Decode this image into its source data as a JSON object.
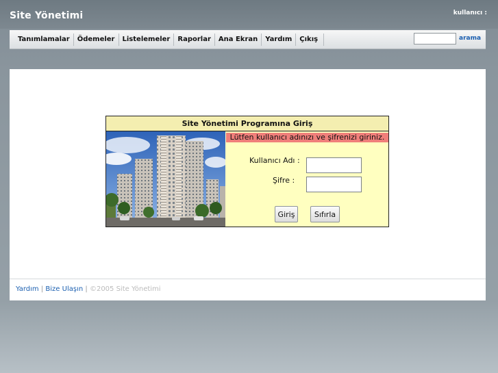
{
  "header": {
    "site_title": "Site Yönetimi",
    "user_label": "kullanıcı :"
  },
  "nav": {
    "items": [
      {
        "label": "Tanımlamalar"
      },
      {
        "label": "Ödemeler"
      },
      {
        "label": "Listelemeler"
      },
      {
        "label": "Raporlar"
      },
      {
        "label": "Ana Ekran"
      },
      {
        "label": "Yardım"
      },
      {
        "label": "Çıkış"
      }
    ],
    "search_value": "",
    "search_link": "arama"
  },
  "login": {
    "title": "Site Yönetimi Programına Giriş",
    "error_message": "Lütfen kullanıcı adınızı ve şifrenizi giriniz.",
    "username_label": "Kullanıcı Adı :",
    "username_value": "",
    "password_label": "Şifre :",
    "password_value": "",
    "submit_label": "Giriş",
    "reset_label": "Sıfırla"
  },
  "footer": {
    "help_link": "Yardım",
    "contact_link": "Bize Ulaşın",
    "separator": "|",
    "copyright": "©2005 Site Yönetimi"
  },
  "colors": {
    "error_bg": "#f07f7a",
    "login_bg": "#ffffc0",
    "link": "#1b5fb0"
  },
  "icons": {
    "login_photo": "apartment-buildings-photo"
  }
}
